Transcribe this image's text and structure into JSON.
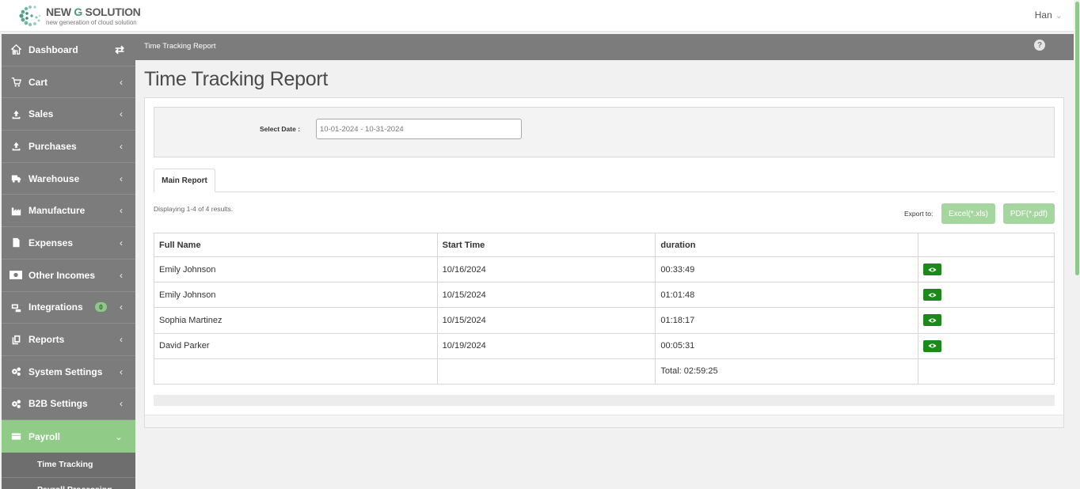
{
  "brand": {
    "title_a": "NEW ",
    "title_g": "G",
    "title_b": " SOLUTION",
    "subtitle": "new generation of cloud solution",
    "accent": "#8fd18a"
  },
  "user": {
    "name": "Han"
  },
  "breadcrumb": "Time Tracking Report",
  "page_title": "Time Tracking Report",
  "sidebar": {
    "items": [
      {
        "label": "Dashboard",
        "icon": "home-icon"
      },
      {
        "label": "Cart",
        "icon": "cart-icon"
      },
      {
        "label": "Sales",
        "icon": "upload-icon"
      },
      {
        "label": "Purchases",
        "icon": "upload-icon"
      },
      {
        "label": "Warehouse",
        "icon": "truck-icon"
      },
      {
        "label": "Manufacture",
        "icon": "factory-icon"
      },
      {
        "label": "Expenses",
        "icon": "file-icon"
      },
      {
        "label": "Other Incomes",
        "icon": "money-icon"
      },
      {
        "label": "Integrations",
        "icon": "integration-icon",
        "badge": "0"
      },
      {
        "label": "Reports",
        "icon": "copy-icon"
      },
      {
        "label": "System Settings",
        "icon": "gears-icon"
      },
      {
        "label": "B2B Settings",
        "icon": "gears-icon"
      },
      {
        "label": "Payroll",
        "icon": "card-icon"
      }
    ],
    "sub_items": [
      "Time Tracking",
      "Payroll Processing"
    ]
  },
  "filter": {
    "label": "Select Date :",
    "value": "10-01-2024 - 10-31-2024"
  },
  "tabs": [
    "Main Report"
  ],
  "summary": "Displaying 1-4 of 4 results.",
  "export": {
    "label": "Export to:",
    "excel": "Excel(*.xls)",
    "pdf": "PDF(*.pdf)"
  },
  "table": {
    "headers": [
      "Full Name",
      "Start Time",
      "duration",
      ""
    ],
    "rows": [
      {
        "name": "Emily Johnson",
        "start": "10/16/2024",
        "duration": "00:33:49"
      },
      {
        "name": "Emily Johnson",
        "start": "10/15/2024",
        "duration": "01:01:48"
      },
      {
        "name": "Sophia Martinez",
        "start": "10/15/2024",
        "duration": "01:18:17"
      },
      {
        "name": "David Parker",
        "start": "10/19/2024",
        "duration": "00:05:31"
      }
    ],
    "total": "Total: 02:59:25"
  }
}
